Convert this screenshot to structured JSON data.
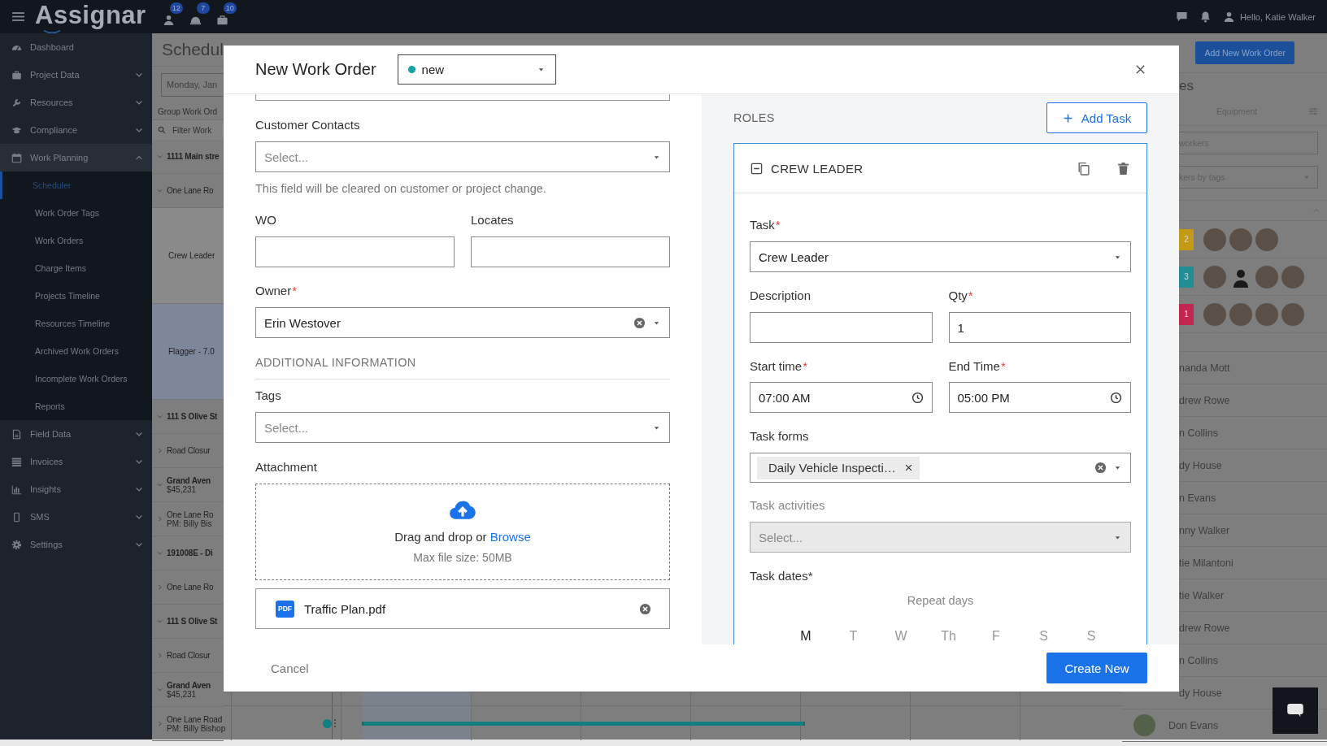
{
  "topbar": {
    "logo": "Assignar",
    "badges": [
      "12",
      "7",
      "10"
    ],
    "greeting": "Hello, Katie Walker"
  },
  "sidebar": {
    "items": [
      {
        "label": "Dashboard"
      },
      {
        "label": "Project Data",
        "expanded": false
      },
      {
        "label": "Resources",
        "expanded": false
      },
      {
        "label": "Compliance",
        "expanded": false
      },
      {
        "label": "Work Planning",
        "expanded": true,
        "children": [
          {
            "label": "Scheduler",
            "selected": true
          },
          {
            "label": "Work Order Tags",
            "selected": false
          },
          {
            "label": "Work Orders",
            "selected": false
          },
          {
            "label": "Charge Items",
            "selected": false
          },
          {
            "label": "Projects Timeline",
            "selected": false
          },
          {
            "label": "Resources Timeline",
            "selected": false
          },
          {
            "label": "Archived Work Orders",
            "selected": false
          },
          {
            "label": "Incomplete Work Orders",
            "selected": false
          },
          {
            "label": "Reports",
            "selected": false
          }
        ]
      },
      {
        "label": "Field Data",
        "expanded": false
      },
      {
        "label": "Invoices",
        "expanded": false
      },
      {
        "label": "Insights",
        "expanded": false
      },
      {
        "label": "SMS",
        "expanded": false
      },
      {
        "label": "Settings",
        "expanded": false
      }
    ]
  },
  "schedule": {
    "title": "Schedul",
    "date": "Monday, Jan",
    "group_label": "Group Work Ord",
    "filter_placeholder": "Filter Work",
    "rows": [
      {
        "kind": "group",
        "title": "1111 Main stre",
        "expanded": true
      },
      {
        "kind": "item",
        "title": "One Lane Ro",
        "expanded": true
      },
      {
        "kind": "role",
        "title": "Crew Leader",
        "selected": false
      },
      {
        "kind": "role",
        "title": "Flagger - 7.0",
        "selected": true
      },
      {
        "kind": "group",
        "title": "111 S Olive St",
        "expanded": true
      },
      {
        "kind": "item",
        "title": "Road Closur",
        "expanded": false
      },
      {
        "kind": "group",
        "title": "Grand Aven",
        "subtitle": "$45,231",
        "expanded": true
      },
      {
        "kind": "item",
        "title": "One Lane Ro",
        "subtitle": "PM: Billy Bis",
        "expanded": false
      },
      {
        "kind": "group",
        "title": "191008E - Di",
        "expanded": true
      },
      {
        "kind": "item",
        "title": "One Lane Ro",
        "expanded": false
      },
      {
        "kind": "group",
        "title": "111 S Olive St",
        "expanded": true
      },
      {
        "kind": "item",
        "title": "Road Closur",
        "expanded": false
      },
      {
        "kind": "group",
        "title": "Grand Aven",
        "subtitle": "$45,231",
        "expanded": true
      },
      {
        "kind": "item",
        "title": "One Lane Road",
        "subtitle": "PM: Billy Bishop",
        "expanded": false
      }
    ]
  },
  "resources": {
    "add_button": "Add New Work Order",
    "title": "es",
    "tabs": [
      {
        "label": "Equipment",
        "selected": false
      }
    ],
    "search_placeholder": "workers",
    "tag_filter_placeholder": "kers by tags",
    "crews": [
      {
        "count": "2",
        "color": "#c29a16",
        "members": [
          {
            "kind": "avatar"
          },
          {
            "kind": "avatar"
          },
          {
            "kind": "avatar"
          }
        ]
      },
      {
        "count": "3",
        "color": "#1f8f93",
        "members": [
          {
            "kind": "avatar"
          },
          {
            "kind": "silhouette"
          },
          {
            "kind": "avatar"
          },
          {
            "kind": "avatar"
          }
        ]
      },
      {
        "count": "1",
        "color": "#c2254f",
        "members": [
          {
            "kind": "avatar"
          },
          {
            "kind": "avatar"
          },
          {
            "kind": "avatar"
          },
          {
            "kind": "avatar"
          }
        ]
      }
    ],
    "workers": [
      {
        "name": "nanda Mott",
        "avatar": false
      },
      {
        "name": "drew Rowe",
        "avatar": false
      },
      {
        "name": "n Collins",
        "avatar": false
      },
      {
        "name": "dy House",
        "avatar": false
      },
      {
        "name": "n Evans",
        "avatar": false
      },
      {
        "name": "nny Walker",
        "avatar": false
      },
      {
        "name": "tie Milantoni",
        "avatar": false
      },
      {
        "name": "tie Walker",
        "avatar": false
      },
      {
        "name": "drew Rowe",
        "avatar": false
      },
      {
        "name": "n Collins",
        "avatar": false
      },
      {
        "name": "dy House",
        "avatar": false
      },
      {
        "name": "Don Evans",
        "avatar": true
      }
    ]
  },
  "modal": {
    "title": "New Work Order",
    "status": {
      "value": "new",
      "color": "#17a2a8"
    },
    "customer_contacts": {
      "label": "Customer Contacts",
      "placeholder": "Select..."
    },
    "helper": "This field will be cleared on customer or project change.",
    "wo": {
      "label": "WO"
    },
    "locates": {
      "label": "Locates"
    },
    "owner": {
      "label": "Owner",
      "required_mark": "*",
      "value": "Erin Westover"
    },
    "section_title": "ADDITIONAL INFORMATION",
    "tags": {
      "label": "Tags",
      "placeholder": "Select..."
    },
    "attachment": {
      "label": "Attachment",
      "drop_text": "Drag and drop or",
      "browse_link": "Browse",
      "limit": "Max file size: 50MB",
      "files": [
        {
          "type_badge": "PDF",
          "name": "Traffic Plan.pdf"
        }
      ]
    },
    "roles": {
      "title": "ROLES",
      "add_button": "Add Task",
      "cards": [
        {
          "title": "CREW LEADER",
          "expanded": true,
          "task": {
            "label": "Task",
            "required_mark": "*",
            "value": "Crew Leader"
          },
          "description": {
            "label": "Description"
          },
          "qty": {
            "label": "Qty",
            "required_mark": "*",
            "value": "1"
          },
          "start_time": {
            "label": "Start time",
            "required_mark": "*",
            "value": "07:00 AM"
          },
          "end_time": {
            "label": "End Time",
            "required_mark": "*",
            "value": "05:00 PM"
          },
          "task_forms": {
            "label": "Task forms",
            "chips": [
              "Daily Vehicle Inspecti…"
            ]
          },
          "task_activities": {
            "label": "Task activities",
            "placeholder": "Select...",
            "disabled": true
          },
          "task_dates": {
            "label": "Task dates*",
            "repeat_label": "Repeat days",
            "days": [
              {
                "label": "M",
                "selected": true
              },
              {
                "label": "T",
                "selected": false
              },
              {
                "label": "W",
                "selected": false
              },
              {
                "label": "Th",
                "selected": false
              },
              {
                "label": "F",
                "selected": false
              },
              {
                "label": "S",
                "selected": false
              },
              {
                "label": "S",
                "selected": false
              }
            ]
          }
        }
      ]
    },
    "cancel": "Cancel",
    "submit": "Create New"
  }
}
